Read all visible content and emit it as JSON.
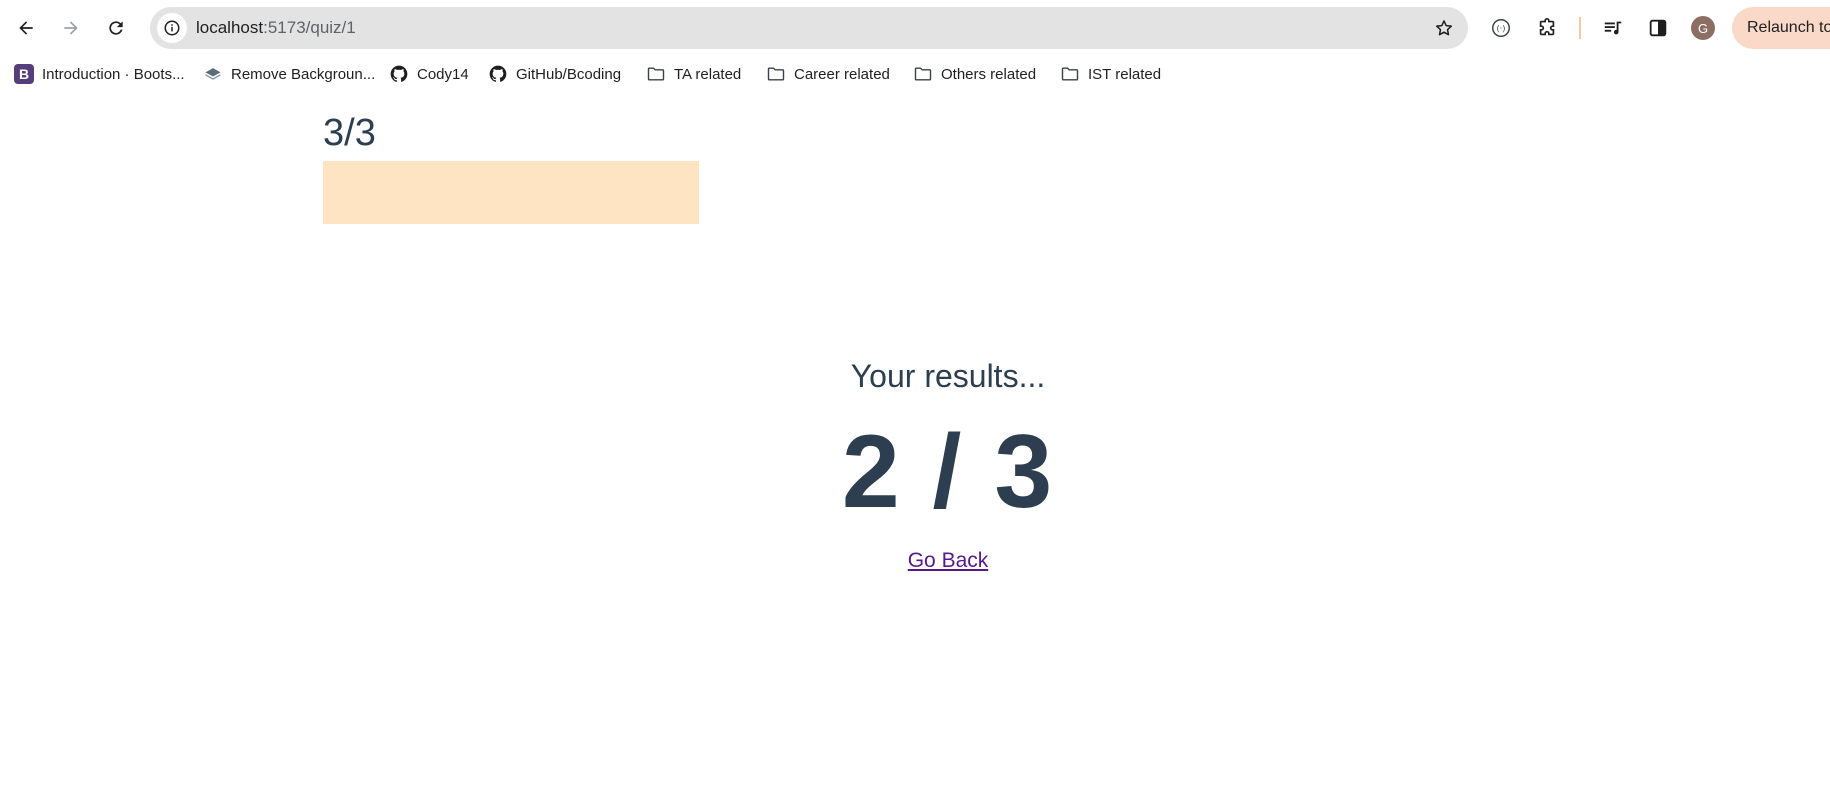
{
  "browser": {
    "url_host": "localhost",
    "url_path": ":5173/quiz/1",
    "profile_initial": "G",
    "relaunch_label": "Relaunch to",
    "colors": {
      "omnibox_bg": "#e3e3e3",
      "relaunch_bg": "#fbd9c8",
      "avatar_bg": "#8d6e63"
    }
  },
  "bookmarks": [
    {
      "label": "Introduction · Boots...",
      "icon": "bootstrap-icon"
    },
    {
      "label": "Remove Backgroun...",
      "icon": "layers-icon"
    },
    {
      "label": "Cody14",
      "icon": "github-icon"
    },
    {
      "label": "GitHub/Bcoding",
      "icon": "github-icon"
    },
    {
      "label": "TA related",
      "icon": "folder-icon"
    },
    {
      "label": "Career related",
      "icon": "folder-icon"
    },
    {
      "label": "Others related",
      "icon": "folder-icon"
    },
    {
      "label": "IST related",
      "icon": "folder-icon"
    }
  ],
  "quiz": {
    "progress_label": "3/3",
    "progress_fraction": 1.0,
    "progress_color": "#ffe4c4",
    "results_heading": "Your results...",
    "score": "2 / 3",
    "go_back_label": "Go Back",
    "text_color": "#2c3e50"
  }
}
